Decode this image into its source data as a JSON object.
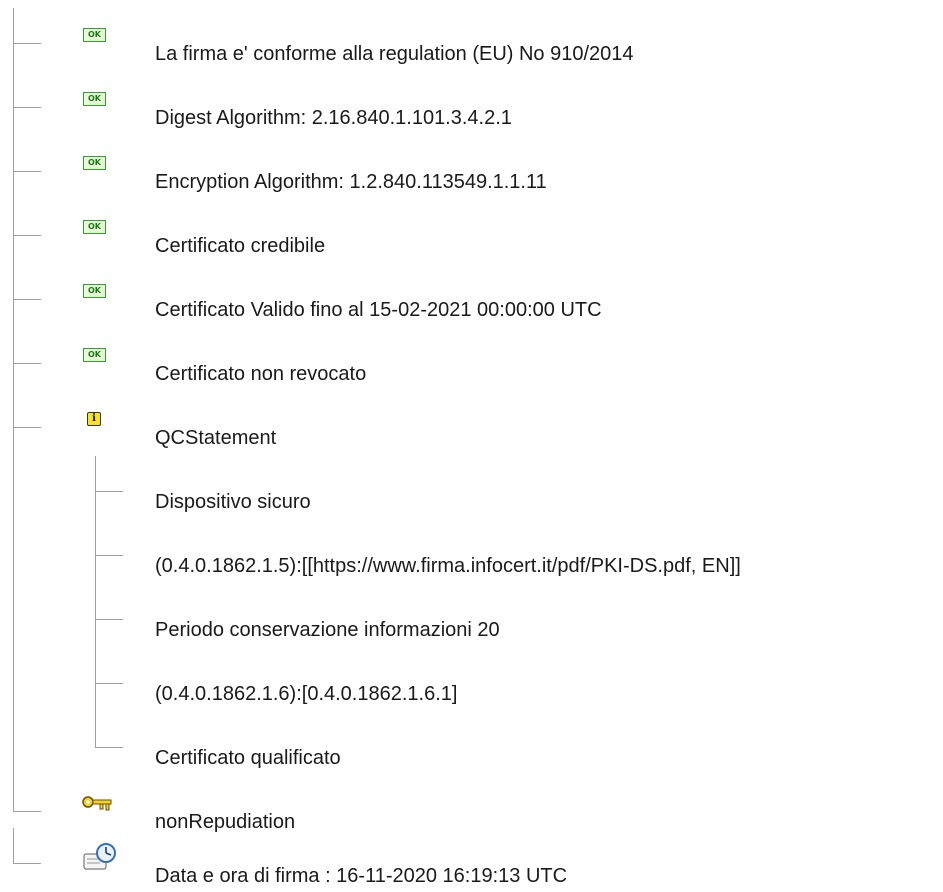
{
  "tree": {
    "items": [
      {
        "label": "La firma e' conforme alla regulation (EU) No 910/2014",
        "icon": "ok-icon",
        "status_text": "OK"
      },
      {
        "label": "Digest Algorithm: 2.16.840.1.101.3.4.2.1",
        "icon": "ok-icon",
        "status_text": "OK"
      },
      {
        "label": "Encryption Algorithm: 1.2.840.113549.1.1.11",
        "icon": "ok-icon",
        "status_text": "OK"
      },
      {
        "label": "Certificato credibile",
        "icon": "ok-icon",
        "status_text": "OK"
      },
      {
        "label": "Certificato Valido fino al 15-02-2021 00:00:00 UTC",
        "icon": "ok-icon",
        "status_text": "OK"
      },
      {
        "label": "Certificato non revocato",
        "icon": "ok-icon",
        "status_text": "OK"
      },
      {
        "label": "QCStatement",
        "icon": "info-icon",
        "status_text": "i"
      },
      {
        "label": "Dispositivo sicuro"
      },
      {
        "label": "(0.4.0.1862.1.5):[[https://www.firma.infocert.it/pdf/PKI-DS.pdf, EN]]"
      },
      {
        "label": "Periodo conservazione informazioni 20"
      },
      {
        "label": "(0.4.0.1862.1.6):[0.4.0.1862.1.6.1]"
      },
      {
        "label": "Certificato qualificato"
      },
      {
        "label": "nonRepudiation",
        "icon": "key-icon"
      },
      {
        "label": "Data e ora di firma : 16-11-2020 16:19:13 UTC",
        "icon": "clock-icon"
      }
    ]
  },
  "colors": {
    "ok_border": "#2fa32f",
    "ok_fill": "#e8f8d8",
    "info_fill": "#f7e51a",
    "tree_line": "#a0a0a0"
  }
}
